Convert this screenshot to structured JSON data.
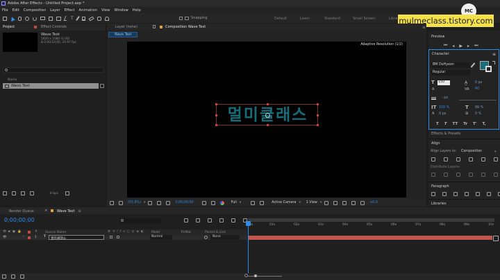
{
  "app": {
    "title": "Adobe After Effects - Untitled Project.aep *",
    "menu": [
      "File",
      "Edit",
      "Composition",
      "Layer",
      "Effect",
      "Animation",
      "View",
      "Window",
      "Help"
    ]
  },
  "toolbar": {
    "snapping_label": "Snapping",
    "workspaces": [
      "Default",
      "Learn",
      "Standard",
      "Small Screen",
      "Libra"
    ]
  },
  "watermark": {
    "url": "mulmeclass.tistory.com",
    "logo_text": "MC"
  },
  "project": {
    "tab": "Project",
    "effect_tab": "Effect Controls",
    "preview_name": "Wave Text",
    "preview_info": [
      "1920 x 1080 (1.00)",
      "Δ 0;00;10;00, 29.97 fps"
    ],
    "search_icon": "search-icon",
    "column_name": "Name",
    "items": [
      {
        "name": "Wave Text"
      }
    ],
    "bpc": "8 bpc"
  },
  "composition": {
    "layer_tab": "Layer (none)",
    "comp_tab": "Composition Wave Text",
    "breadcrumb": "Wave Text",
    "resolution_badge": "Adaptive Resolution (1/2)",
    "canvas_text": "멀미클래스",
    "canvas_text_color": "#156d7a",
    "footer": {
      "zoom": "(55.8%)",
      "timecode": "0;00;00;00",
      "quality": "Full",
      "camera": "Active Camera",
      "view": "1 View",
      "exposure": "+0.0"
    }
  },
  "right_panel": {
    "preview_label": "Preview",
    "character": {
      "label": "Character",
      "font": "BM DoHyeon",
      "style": "Regular",
      "size": "150",
      "tracking": "0 px",
      "kerning": "40",
      "leading": "- px",
      "vscale": "100 %",
      "hscale": "99 %",
      "baseline": "0 px",
      "tsume": "0 %",
      "styles": [
        "T",
        "T",
        "TT",
        "Tr",
        "T'",
        "T,"
      ],
      "fill_color": "#1b6b78"
    },
    "effects_presets_label": "Effects & Presets",
    "align": {
      "label": "Align",
      "align_to_label": "Align Layers to:",
      "align_to_value": "Composition",
      "distribute_label": "Distribute Layers:"
    },
    "paragraph_label": "Paragraph",
    "libraries_label": "Libraries"
  },
  "timeline": {
    "render_queue_tab": "Render Queue",
    "comp_tab": "Wave Text",
    "timecode": "0;00;00;00",
    "columns": {
      "source_name": "Source Name",
      "mode": "Mode",
      "trkmat": "TrkMat",
      "parent": "Parent & Link"
    },
    "layers": [
      {
        "number": "1",
        "type": "T",
        "name": "멀미클래스",
        "mode": "Normal",
        "parent": "None"
      }
    ],
    "ruler": [
      "0s",
      "02s",
      "04s",
      "06s",
      "08s",
      "10s"
    ],
    "ruler_mid": [
      "01s",
      "03s",
      "05s",
      "07s",
      "09s"
    ],
    "bar_color": "#c0564f"
  }
}
